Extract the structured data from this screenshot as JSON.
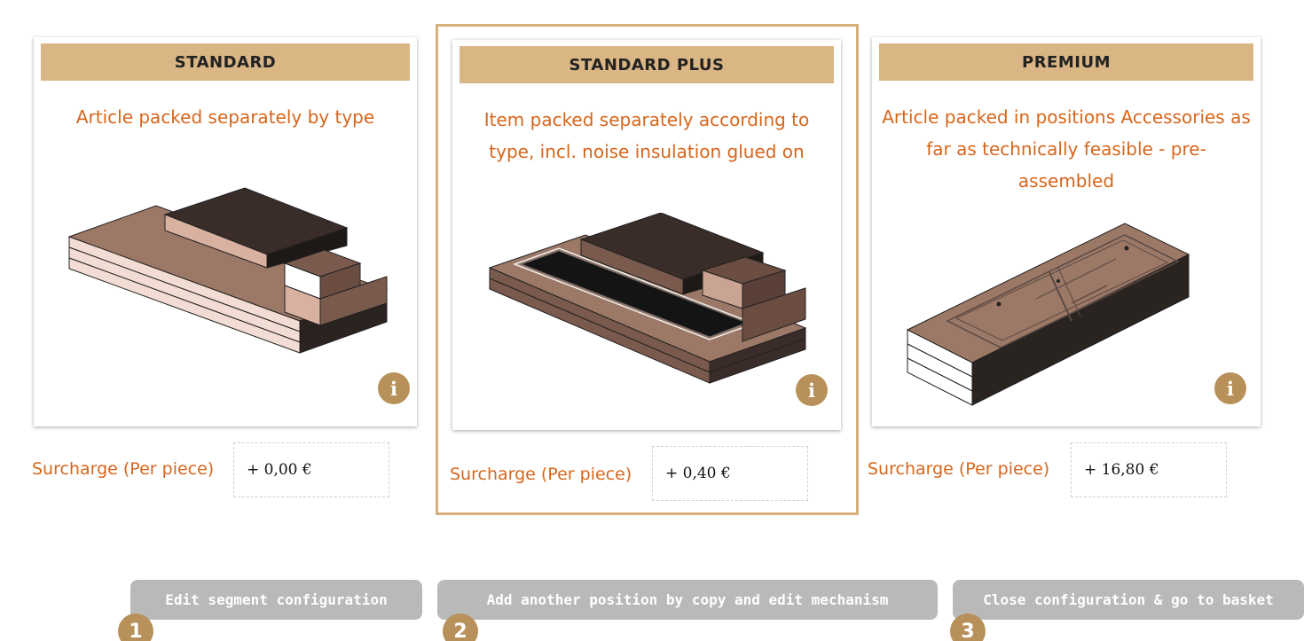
{
  "options": [
    {
      "title": "STANDARD",
      "description": "Article packed separately by type",
      "surcharge_label": "Surcharge (Per piece)",
      "surcharge_value": "+ 0,00 €",
      "info_icon": "info-icon",
      "selected": false
    },
    {
      "title": "STANDARD PLUS",
      "description": "Item packed separately according to type, incl. noise insulation glued on",
      "surcharge_label": "Surcharge (Per piece)",
      "surcharge_value": "+ 0,40 €",
      "info_icon": "info-icon",
      "selected": true
    },
    {
      "title": "PREMIUM",
      "description": "Article packed in positions Accessories as far as technically feasible - pre-assembled",
      "surcharge_label": "Surcharge (Per piece)",
      "surcharge_value": "+ 16,80 €",
      "info_icon": "info-icon",
      "selected": false
    }
  ],
  "actions": [
    {
      "step": "1",
      "label": "Edit segment configuration"
    },
    {
      "step": "2",
      "label": "Add another position by copy and edit mechanism"
    },
    {
      "step": "3",
      "label": "Close configuration & go to basket"
    }
  ],
  "colors": {
    "header_bg": "#dab684",
    "accent_text": "#d6661c",
    "info_button": "#b8905a",
    "selected_border": "#d6b17a",
    "action_button": "#b9b9b9"
  }
}
